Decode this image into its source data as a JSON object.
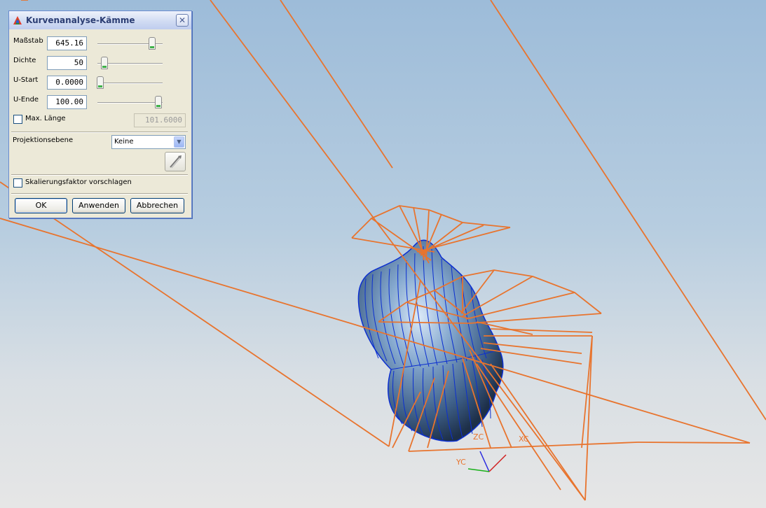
{
  "dialog": {
    "title": "Kurvenanalyse-Kämme",
    "close_symbol": "✕",
    "fields": [
      {
        "label": "Maßstab",
        "value": "645.16",
        "slider_level": 0.82
      },
      {
        "label": "Dichte",
        "value": "50",
        "slider_level": 0.06
      },
      {
        "label": "U-Start",
        "value": "0.0000",
        "slider_level": 0.0
      },
      {
        "label": "U-Ende",
        "value": "100.00",
        "slider_level": 1.0
      }
    ],
    "max_length": {
      "label": "Max. Länge",
      "checked": false,
      "value": "101.6000"
    },
    "projection": {
      "label": "Projektionsebene",
      "selected": "Keine"
    },
    "suggest_scale": {
      "label": "Skalierungsfaktor vorschlagen",
      "checked": false
    },
    "buttons": {
      "ok": "OK",
      "apply": "Anwenden",
      "cancel": "Abbrechen"
    },
    "icons": {
      "app": "nx-app-icon",
      "pick": "vector-pick-icon",
      "close": "close-icon"
    }
  },
  "viewport": {
    "axes": {
      "x": "XC",
      "y": "YC",
      "z": "ZC"
    },
    "colors": {
      "comb": "#e8742e",
      "surface": "#5b86b8",
      "isolines": "#0c2fd0",
      "bg_top": "#9dbcd9",
      "bg_bottom": "#e6e6e6"
    }
  }
}
